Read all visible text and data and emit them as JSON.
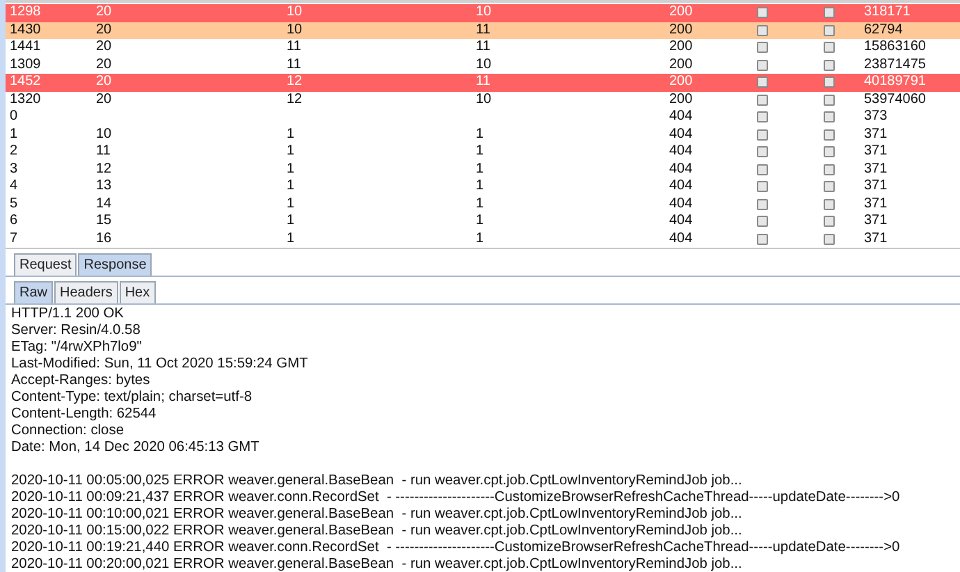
{
  "table": {
    "rows": [
      {
        "cells": [
          "1298",
          "20",
          "10",
          "10",
          "200",
          "",
          "",
          "318171"
        ],
        "checks": [
          false,
          false
        ],
        "flagged": true,
        "selected": false
      },
      {
        "cells": [
          "1430",
          "20",
          "10",
          "11",
          "200",
          "",
          "",
          "62794"
        ],
        "checks": [
          false,
          false
        ],
        "flagged": false,
        "selected": true
      },
      {
        "cells": [
          "1441",
          "20",
          "11",
          "11",
          "200",
          "",
          "",
          "15863160"
        ],
        "checks": [
          false,
          false
        ],
        "flagged": false,
        "selected": false
      },
      {
        "cells": [
          "1309",
          "20",
          "11",
          "10",
          "200",
          "",
          "",
          "23871475"
        ],
        "checks": [
          false,
          false
        ],
        "flagged": false,
        "selected": false
      },
      {
        "cells": [
          "1452",
          "20",
          "12",
          "11",
          "200",
          "",
          "",
          "40189791"
        ],
        "checks": [
          false,
          false
        ],
        "flagged": true,
        "selected": false
      },
      {
        "cells": [
          "1320",
          "20",
          "12",
          "10",
          "200",
          "",
          "",
          "53974060"
        ],
        "checks": [
          false,
          false
        ],
        "flagged": false,
        "selected": false
      },
      {
        "cells": [
          "0",
          "",
          "",
          "",
          "404",
          "",
          "",
          "373"
        ],
        "checks": [
          false,
          false
        ],
        "flagged": false,
        "selected": false
      },
      {
        "cells": [
          "1",
          "10",
          "1",
          "1",
          "404",
          "",
          "",
          "371"
        ],
        "checks": [
          false,
          false
        ],
        "flagged": false,
        "selected": false
      },
      {
        "cells": [
          "2",
          "11",
          "1",
          "1",
          "404",
          "",
          "",
          "371"
        ],
        "checks": [
          false,
          false
        ],
        "flagged": false,
        "selected": false
      },
      {
        "cells": [
          "3",
          "12",
          "1",
          "1",
          "404",
          "",
          "",
          "371"
        ],
        "checks": [
          false,
          false
        ],
        "flagged": false,
        "selected": false
      },
      {
        "cells": [
          "4",
          "13",
          "1",
          "1",
          "404",
          "",
          "",
          "371"
        ],
        "checks": [
          false,
          false
        ],
        "flagged": false,
        "selected": false
      },
      {
        "cells": [
          "5",
          "14",
          "1",
          "1",
          "404",
          "",
          "",
          "371"
        ],
        "checks": [
          false,
          false
        ],
        "flagged": false,
        "selected": false
      },
      {
        "cells": [
          "6",
          "15",
          "1",
          "1",
          "404",
          "",
          "",
          "371"
        ],
        "checks": [
          false,
          false
        ],
        "flagged": false,
        "selected": false
      },
      {
        "cells": [
          "7",
          "16",
          "1",
          "1",
          "404",
          "",
          "",
          "371"
        ],
        "checks": [
          false,
          false
        ],
        "flagged": false,
        "selected": false
      }
    ]
  },
  "tabs": [
    {
      "label": "Request",
      "selected": false
    },
    {
      "label": "Response",
      "selected": true
    }
  ],
  "subtabs": [
    {
      "label": "Raw",
      "selected": true
    },
    {
      "label": "Headers",
      "selected": false
    },
    {
      "label": "Hex",
      "selected": false
    }
  ],
  "response_headers": [
    "HTTP/1.1 200 OK",
    "Server: Resin/4.0.58",
    "ETag: \"/4rwXPh7lo9\"",
    "Last-Modified: Sun, 11 Oct 2020 15:59:24 GMT",
    "Accept-Ranges: bytes",
    "Content-Type: text/plain; charset=utf-8",
    "Content-Length: 62544",
    "Connection: close",
    "Date: Mon, 14 Dec 2020 06:45:13 GMT"
  ],
  "response_body": [
    "2020-10-11 00:05:00,025 ERROR weaver.general.BaseBean  - run weaver.cpt.job.CptLowInventoryRemindJob job...",
    "2020-10-11 00:09:21,437 ERROR weaver.conn.RecordSet  - ---------------------CustomizeBrowserRefreshCacheThread-----updateDate-------->0",
    "2020-10-11 00:10:00,021 ERROR weaver.general.BaseBean  - run weaver.cpt.job.CptLowInventoryRemindJob job...",
    "2020-10-11 00:15:00,022 ERROR weaver.general.BaseBean  - run weaver.cpt.job.CptLowInventoryRemindJob job...",
    "2020-10-11 00:19:21,440 ERROR weaver.conn.RecordSet  - ---------------------CustomizeBrowserRefreshCacheThread-----updateDate-------->0",
    "2020-10-11 00:20:00,021 ERROR weaver.general.BaseBean  - run weaver.cpt.job.CptLowInventoryRemindJob job..."
  ]
}
